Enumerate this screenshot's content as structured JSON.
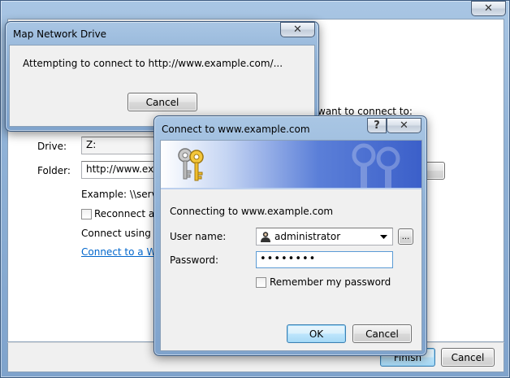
{
  "background_wizard": {
    "close_label": "✕",
    "want_text": "want to connect to:",
    "drive_label": "Drive:",
    "drive_value": "Z:",
    "folder_label": "Folder:",
    "folder_value": "http://www.exar",
    "example_text": "Example: \\\\server",
    "reconnect_label": "Reconnect at l",
    "connect_using_text": "Connect using a",
    "connect_web_link": "Connect to a Web",
    "finish_label": "Finish",
    "cancel_label": "Cancel"
  },
  "map_network_dialog": {
    "title": "Map Network Drive",
    "close_label": "✕",
    "message": "Attempting to connect to http://www.example.com/...",
    "cancel_label": "Cancel"
  },
  "connect_dialog": {
    "title": "Connect to www.example.com",
    "help_label": "?",
    "close_label": "✕",
    "connecting_text": "Connecting to www.example.com",
    "username_label": "User name:",
    "username_value": "administrator",
    "password_label": "Password:",
    "password_value": "••••••••",
    "browse_label": "...",
    "remember_label": "Remember my password",
    "ok_label": "OK",
    "cancel_label": "Cancel"
  },
  "icons": {
    "banner": "keys-icon",
    "user": "user-icon",
    "dropdown": "chevron-down-icon"
  }
}
